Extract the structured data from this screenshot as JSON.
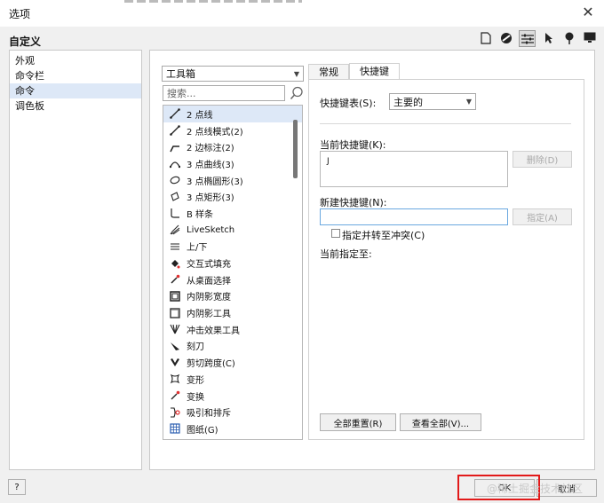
{
  "window": {
    "title": "选项",
    "close": "✕"
  },
  "section_title": "自定义",
  "toolbar_icons": [
    "page-icon",
    "palette-icon",
    "sliders-icon",
    "cursor-icon",
    "pin-icon",
    "monitor-icon"
  ],
  "tree": {
    "items": [
      {
        "label": "外观",
        "selected": false
      },
      {
        "label": "命令栏",
        "selected": false
      },
      {
        "label": "命令",
        "selected": true
      },
      {
        "label": "调色板",
        "selected": false
      }
    ]
  },
  "command_panel": {
    "category_value": "工具箱",
    "search_placeholder": "搜索...",
    "items": [
      {
        "label": "2 点线",
        "icon": "two-point-line-icon",
        "selected": true
      },
      {
        "label": "2 点线模式(2)",
        "icon": "two-point-line-mode-icon"
      },
      {
        "label": "2 边标注(2)",
        "icon": "two-segment-callout-icon"
      },
      {
        "label": "3 点曲线(3)",
        "icon": "three-point-curve-icon"
      },
      {
        "label": "3 点椭圆形(3)",
        "icon": "three-point-ellipse-icon"
      },
      {
        "label": "3 点矩形(3)",
        "icon": "three-point-rectangle-icon"
      },
      {
        "label": "B 样条",
        "icon": "b-spline-icon"
      },
      {
        "label": "LiveSketch",
        "icon": "livesketch-icon"
      },
      {
        "label": "上/下",
        "icon": "up-down-icon"
      },
      {
        "label": "交互式填充",
        "icon": "interactive-fill-icon"
      },
      {
        "label": "从桌面选择",
        "icon": "eyedropper-icon"
      },
      {
        "label": "内阴影宽度",
        "icon": "inner-shadow-width-icon"
      },
      {
        "label": "内阴影工具",
        "icon": "inner-shadow-tool-icon"
      },
      {
        "label": "冲击效果工具",
        "icon": "impact-effect-icon"
      },
      {
        "label": "刻刀",
        "icon": "knife-icon"
      },
      {
        "label": "剪切跨度(C)",
        "icon": "cut-span-icon"
      },
      {
        "label": "变形",
        "icon": "distort-icon"
      },
      {
        "label": "变换",
        "icon": "transform-icon"
      },
      {
        "label": "吸引和排斥",
        "icon": "attract-repel-icon"
      },
      {
        "label": "图纸(G)",
        "icon": "graph-paper-icon"
      }
    ]
  },
  "tabs": [
    {
      "label": "常规",
      "active": false
    },
    {
      "label": "快捷键",
      "active": true
    }
  ],
  "shortcuts": {
    "table_label": "快捷键表(S):",
    "table_value": "主要的",
    "current_label": "当前快捷键(K):",
    "current_value": "J",
    "delete_button": "删除(D)",
    "new_label": "新建快捷键(N):",
    "new_value": "",
    "assign_button": "指定(A)",
    "conflict_checkbox": "指定并转至冲突(C)",
    "assigned_to_label": "当前指定至:",
    "reset_all_button": "全部重置(R)",
    "view_all_button": "查看全部(V)..."
  },
  "footer": {
    "help_button": "?",
    "ok_button": "OK",
    "cancel_button": "取消",
    "watermark": "@稀土掘金技术社区"
  }
}
